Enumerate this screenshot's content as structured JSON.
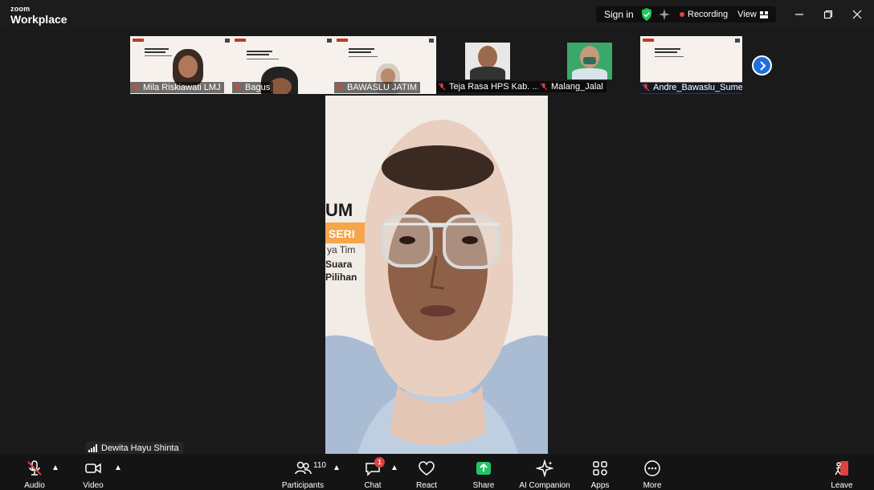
{
  "app": {
    "brand_small": "zoom",
    "brand_large": "Workplace"
  },
  "status": {
    "sign_in": "Sign in",
    "recording": "Recording",
    "view": "View"
  },
  "gallery": {
    "tiles": [
      {
        "name": "Mila Riskiawati LMJ"
      },
      {
        "name": "Bagus"
      },
      {
        "name": "BAWASLU JATIM"
      },
      {
        "name": "Teja Rasa HPS Kab. ..."
      },
      {
        "name": "Malang_Jalal"
      },
      {
        "name": "Andre_Bawaslu_Sume..."
      }
    ],
    "next_icon": "chevron-right-icon"
  },
  "main": {
    "slide_fragments": [
      "UM",
      "SERI",
      "ya Tim",
      "Suara",
      "Pilihan"
    ],
    "speaker_name": "Dewita Hayu Shinta"
  },
  "toolbar": {
    "audio": "Audio",
    "video": "Video",
    "participants": "Participants",
    "participants_count": "110",
    "chat": "Chat",
    "chat_badge": "1",
    "react": "React",
    "share": "Share",
    "ai_companion": "AI Companion",
    "apps": "Apps",
    "more": "More",
    "leave": "Leave"
  },
  "colors": {
    "accent": "#1e6fe0",
    "recording": "#e0413e",
    "share": "#20c565",
    "shield": "#22c55e",
    "leave": "#e0413e"
  }
}
